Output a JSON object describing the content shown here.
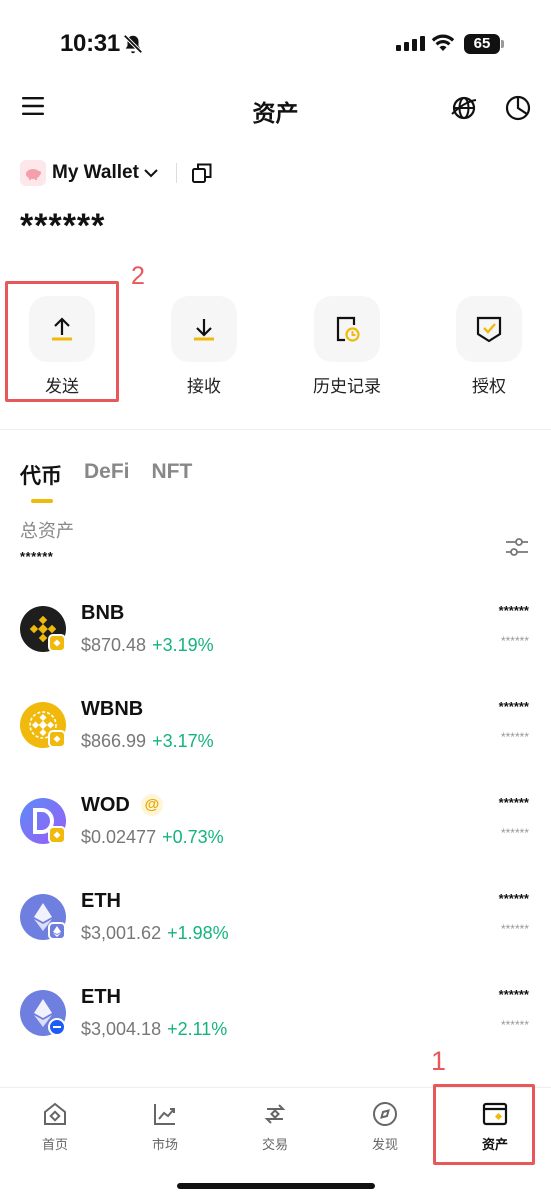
{
  "status_bar": {
    "time": "10:31",
    "battery": "65"
  },
  "header": {
    "title": "资产"
  },
  "wallet": {
    "name": "My Wallet",
    "balance": "******"
  },
  "actions": [
    {
      "label": "发送",
      "icon": "upload-icon"
    },
    {
      "label": "接收",
      "icon": "download-icon"
    },
    {
      "label": "历史记录",
      "icon": "history-icon"
    },
    {
      "label": "授权",
      "icon": "authorize-icon"
    }
  ],
  "tabs": [
    "代币",
    "DeFi",
    "NFT"
  ],
  "total": {
    "label": "总资产",
    "value": "******"
  },
  "tokens": [
    {
      "symbol": "BNB",
      "price": "$870.48",
      "change": "+3.19%",
      "amount": "******",
      "value": "******",
      "color": "#1e1e1e"
    },
    {
      "symbol": "WBNB",
      "price": "$866.99",
      "change": "+3.17%",
      "amount": "******",
      "value": "******",
      "color": "#f0b90b"
    },
    {
      "symbol": "WOD",
      "price": "$0.02477",
      "change": "+0.73%",
      "amount": "******",
      "value": "******",
      "color": "#7b6cf6",
      "badge": "@"
    },
    {
      "symbol": "ETH",
      "price": "$3,001.62",
      "change": "+1.98%",
      "amount": "******",
      "value": "******",
      "color": "#6f7fe0"
    },
    {
      "symbol": "ETH",
      "price": "$3,004.18",
      "change": "+2.11%",
      "amount": "******",
      "value": "******",
      "color": "#6f7fe0"
    }
  ],
  "nav": [
    {
      "label": "首页",
      "icon": "home-icon"
    },
    {
      "label": "市场",
      "icon": "market-chart-icon"
    },
    {
      "label": "交易",
      "icon": "trade-icon"
    },
    {
      "label": "发现",
      "icon": "discover-icon"
    },
    {
      "label": "资产",
      "icon": "assets-wallet-icon"
    }
  ],
  "annotations": {
    "one": "1",
    "two": "2"
  },
  "colors": {
    "accent": "#f0b90b",
    "positive": "#14b47f",
    "annotation": "#e8585a"
  }
}
